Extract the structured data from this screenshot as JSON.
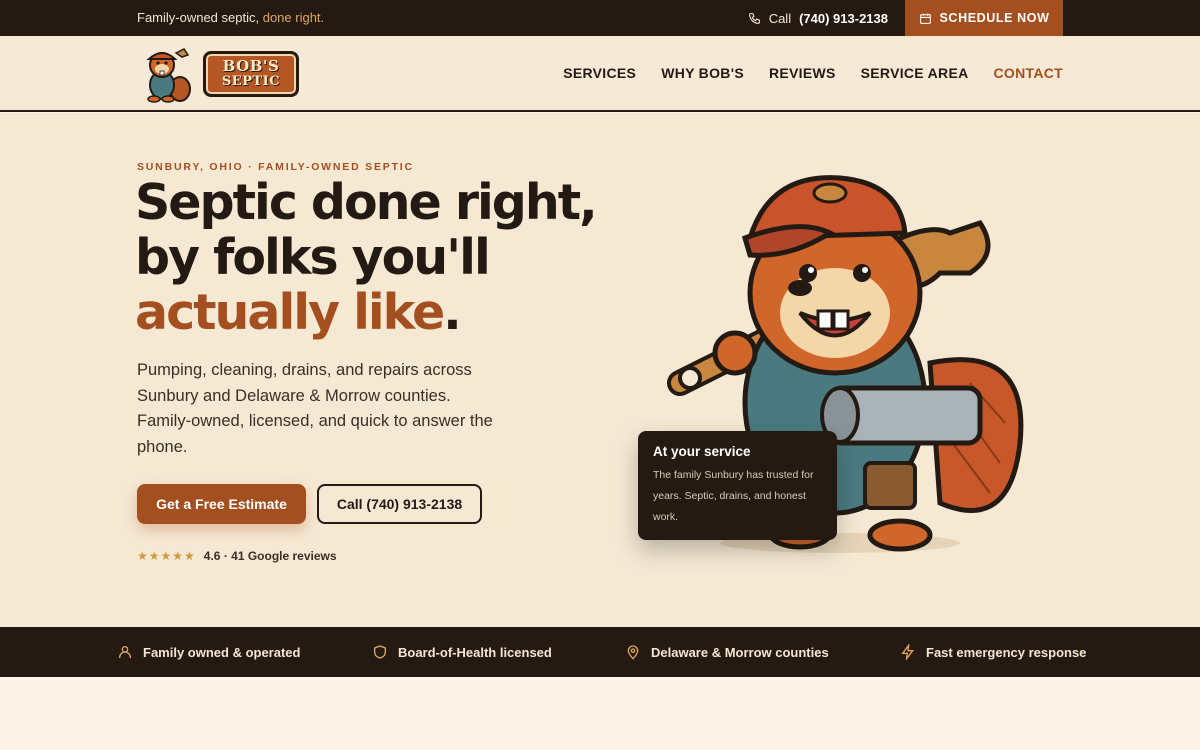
{
  "topbar": {
    "tagline_prefix": "Family-owned septic, ",
    "tagline_highlight": "done right.",
    "call_label": "Call",
    "phone": "(740) 913-2138",
    "schedule_label": "SCHEDULE NOW"
  },
  "brand": {
    "name_line1": "BOB'S",
    "name_line2": "SEPTIC"
  },
  "nav": {
    "items": [
      {
        "label": "SERVICES"
      },
      {
        "label": "WHY BOB'S"
      },
      {
        "label": "REVIEWS"
      },
      {
        "label": "SERVICE AREA"
      },
      {
        "label": "CONTACT"
      }
    ]
  },
  "hero": {
    "eyebrow": "SUNBURY, OHIO · FAMILY-OWNED SEPTIC",
    "headline_line1": "Septic done right,",
    "headline_line2": "by folks you'll",
    "headline_accent": "actually like",
    "headline_period": ".",
    "lead": "Pumping, cleaning, drains, and repairs across Sunbury and Delaware & Morrow counties. Family-owned, licensed, and quick to answer the phone.",
    "cta_primary": "Get a Free Estimate",
    "cta_secondary": "Call (740) 913-2138",
    "stars": "★★★★★",
    "rating_text": "4.6 · 41 Google reviews"
  },
  "service_card": {
    "title": "At your service",
    "body": "The family Sunbury has trusted for years. Septic, drains, and honest work."
  },
  "features": [
    {
      "label": "Family owned & operated",
      "icon": "person-icon"
    },
    {
      "label": "Board-of-Health licensed",
      "icon": "shield-icon"
    },
    {
      "label": "Delaware & Morrow counties",
      "icon": "map-pin-icon"
    },
    {
      "label": "Fast emergency response",
      "icon": "lightning-icon"
    }
  ],
  "colors": {
    "accent": "#a34f1f",
    "dark": "#251a12",
    "cream": "#f6e9d4",
    "star": "#d0973d"
  }
}
